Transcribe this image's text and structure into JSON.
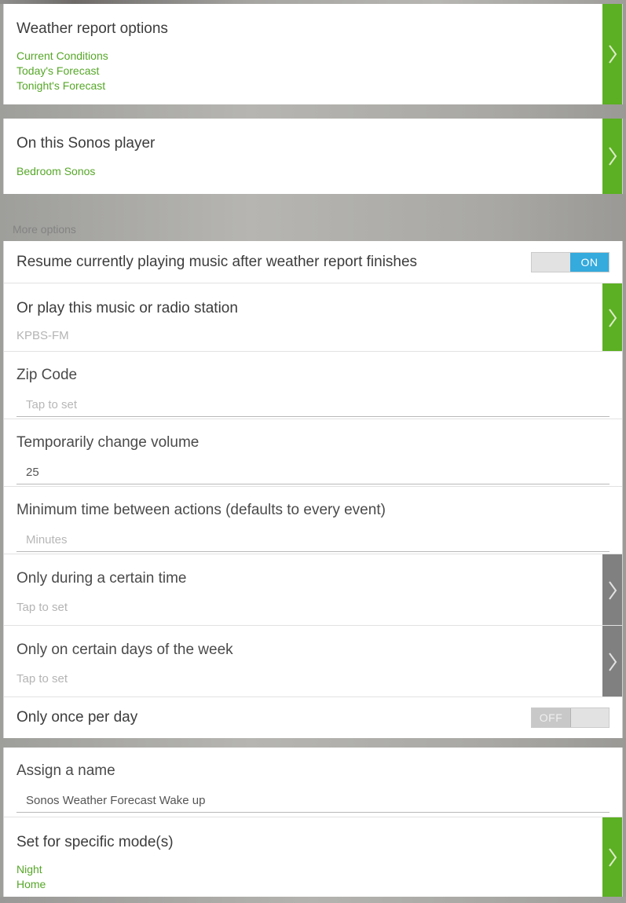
{
  "cards": {
    "weather_report": {
      "title": "Weather report options",
      "options": [
        "Current Conditions",
        "Today's Forecast",
        "Tonight's Forecast"
      ],
      "chevron": "chevron-right-icon",
      "chevron_color": "#5cb023"
    },
    "sonos_player": {
      "title": "On this Sonos player",
      "value": "Bedroom Sonos",
      "chevron": "chevron-right-icon",
      "chevron_color": "#5cb023"
    },
    "more_options_label": "More options",
    "resume_music": {
      "title": "Resume currently playing music after weather report finishes",
      "toggle_state": "ON",
      "toggle_on_color": "#35aadc"
    },
    "radio_station": {
      "title": "Or play this music or radio station",
      "value": "KPBS-FM",
      "chevron": "chevron-right-icon",
      "chevron_color": "#5cb023"
    },
    "zip_code": {
      "title": "Zip Code",
      "placeholder": "Tap to set",
      "value": ""
    },
    "volume": {
      "title": "Temporarily change volume",
      "placeholder": "",
      "value": "25"
    },
    "min_time": {
      "title": "Minimum time between actions (defaults to every event)",
      "placeholder": "Minutes",
      "value": ""
    },
    "certain_time": {
      "title": "Only during a certain time",
      "value": "Tap to set",
      "chevron": "chevron-right-icon",
      "chevron_color": "#808080"
    },
    "certain_days": {
      "title": "Only on certain days of the week",
      "value": "Tap to set",
      "chevron": "chevron-right-icon",
      "chevron_color": "#808080"
    },
    "once_per_day": {
      "title": "Only once per day",
      "toggle_state": "OFF"
    },
    "assign_name": {
      "title": "Assign a name",
      "value": "Sonos Weather Forecast Wake up",
      "placeholder": ""
    },
    "specific_modes": {
      "title": "Set for specific mode(s)",
      "modes": [
        "Night",
        "Home"
      ],
      "chevron": "chevron-right-icon",
      "chevron_color": "#5cb023"
    }
  }
}
